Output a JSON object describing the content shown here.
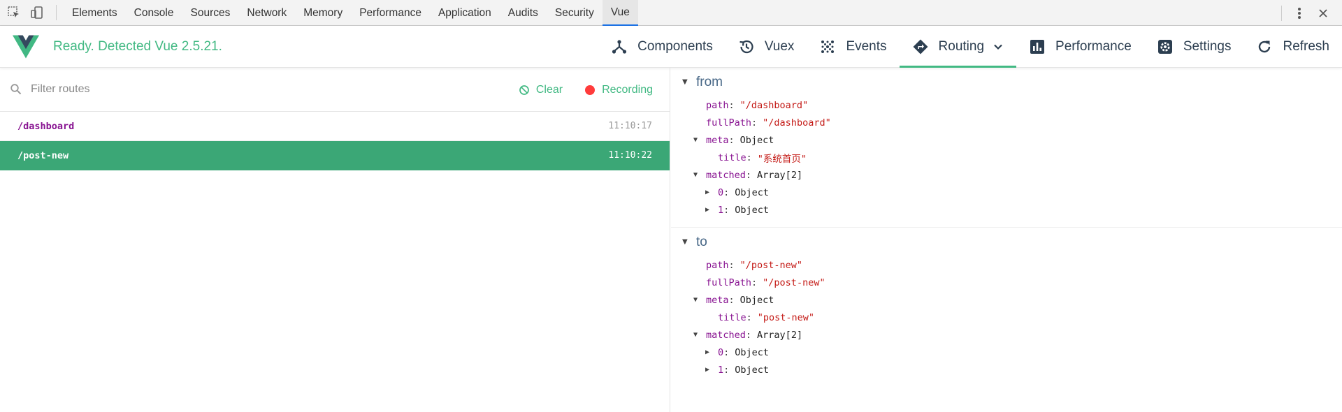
{
  "devtools": {
    "tabs": [
      "Elements",
      "Console",
      "Sources",
      "Network",
      "Memory",
      "Performance",
      "Application",
      "Audits",
      "Security",
      "Vue"
    ],
    "active_tab": "Vue"
  },
  "header": {
    "status": "Ready. Detected Vue 2.5.21.",
    "nav": {
      "components": "Components",
      "vuex": "Vuex",
      "events": "Events",
      "routing": "Routing",
      "performance": "Performance",
      "settings": "Settings",
      "refresh": "Refresh"
    },
    "active_nav": "Routing",
    "accent": "#42b983"
  },
  "filter": {
    "placeholder": "Filter routes",
    "clear_label": "Clear",
    "recording_label": "Recording"
  },
  "routes": [
    {
      "path": "/dashboard",
      "time": "11:10:17",
      "selected": false
    },
    {
      "path": "/post-new",
      "time": "11:10:22",
      "selected": true
    }
  ],
  "details": {
    "from": {
      "title": "from",
      "path_key": "path",
      "path_val": "\"/dashboard\"",
      "fullpath_key": "fullPath",
      "fullpath_val": "\"/dashboard\"",
      "meta_key": "meta",
      "meta_type": "Object",
      "meta_title_key": "title",
      "meta_title_val": "\"系统首页\"",
      "matched_key": "matched",
      "matched_type": "Array[2]",
      "m0_key": "0",
      "m0_type": "Object",
      "m1_key": "1",
      "m1_type": "Object"
    },
    "to": {
      "title": "to",
      "path_key": "path",
      "path_val": "\"/post-new\"",
      "fullpath_key": "fullPath",
      "fullpath_val": "\"/post-new\"",
      "meta_key": "meta",
      "meta_type": "Object",
      "meta_title_key": "title",
      "meta_title_val": "\"post-new\"",
      "matched_key": "matched",
      "matched_type": "Array[2]",
      "m0_key": "0",
      "m0_type": "Object",
      "m1_key": "1",
      "m1_type": "Object"
    }
  }
}
